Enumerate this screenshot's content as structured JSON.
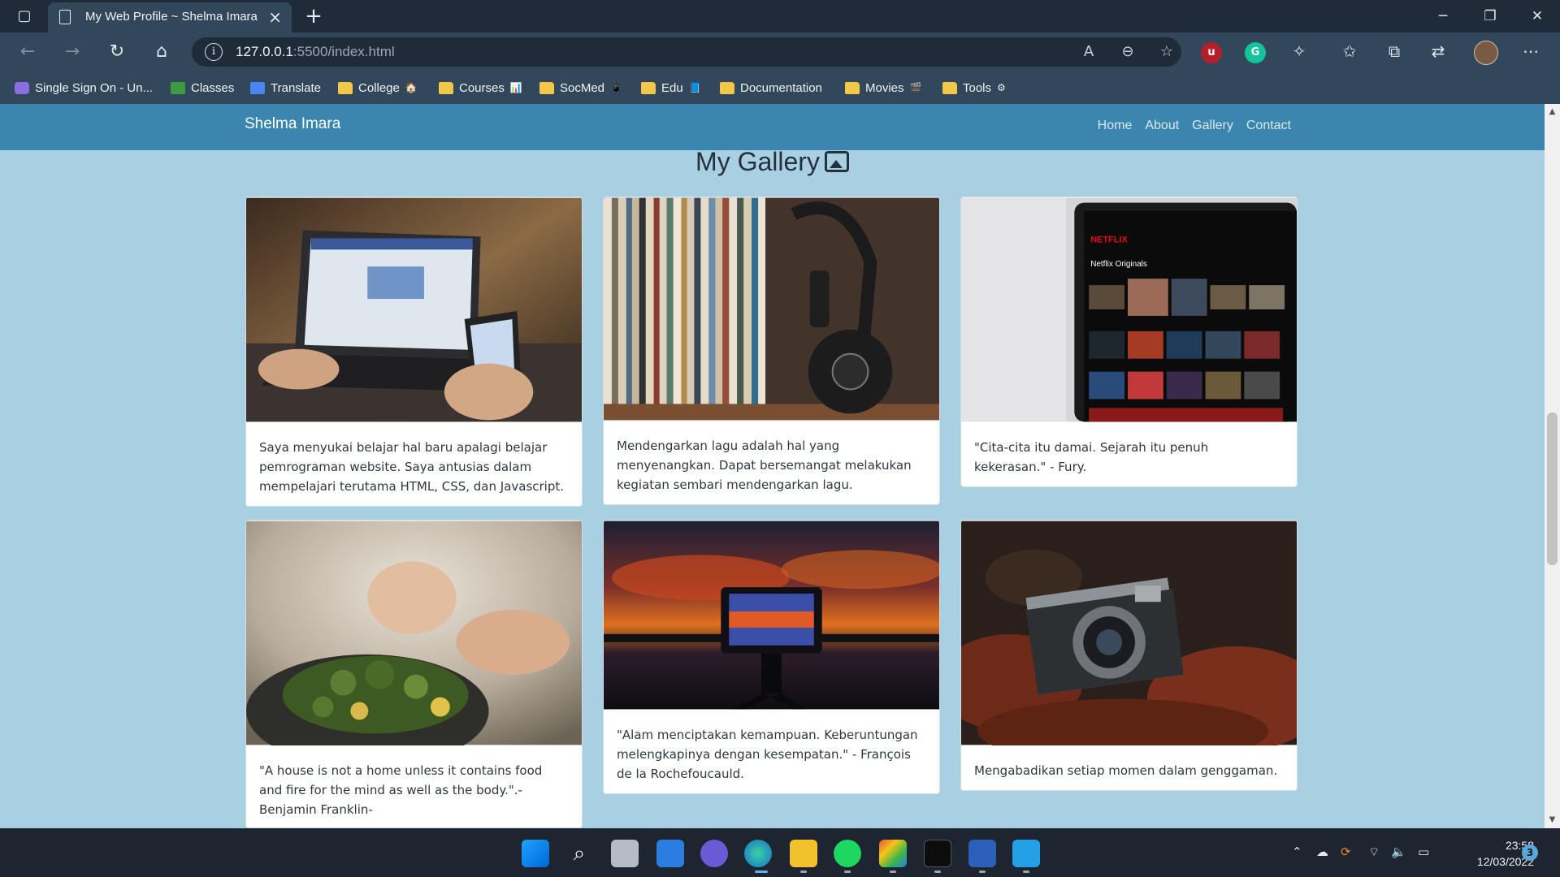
{
  "browser": {
    "tab_title": "My Web Profile ~ Shelma Imara",
    "url_host": "127.0.0.1",
    "url_rest": ":5500/index.html",
    "bookmarks": [
      {
        "label": "Single Sign On - Un...",
        "emoji": ""
      },
      {
        "label": "Classes",
        "emoji": ""
      },
      {
        "label": "Translate",
        "emoji": ""
      },
      {
        "label": "College",
        "emoji": "🏠"
      },
      {
        "label": "Courses",
        "emoji": "📊"
      },
      {
        "label": "SocMed",
        "emoji": "📱"
      },
      {
        "label": "Edu",
        "emoji": "📘"
      },
      {
        "label": "Documentation",
        "emoji": ""
      },
      {
        "label": "Movies",
        "emoji": "🎬"
      },
      {
        "label": "Tools",
        "emoji": "⚙"
      }
    ]
  },
  "site": {
    "brand": "Shelma Imara",
    "nav": [
      "Home",
      "About",
      "Gallery",
      "Contact"
    ],
    "gallery_title": "My Gallery",
    "cards": [
      {
        "image": "laptop-phone-photo",
        "text": "Saya menyukai belajar hal baru apalagi belajar pemrograman website. Saya antusias dalam mempelajari terutama HTML, CSS, dan Javascript."
      },
      {
        "image": "vinyl-headphones-photo",
        "text": "Mendengarkan lagu adalah hal yang menyenangkan. Dapat bersemangat melakukan kegiatan sembari mendengarkan lagu."
      },
      {
        "image": "netflix-tablet-photo",
        "text": "\"Cita-cita itu damai. Sejarah itu penuh kekerasan.\" - Fury."
      },
      {
        "image": "cooking-food-photo",
        "text": "\"A house is not a home unless it contains food and fire for the mind as well as the body.\".-Benjamin Franklin-"
      },
      {
        "image": "sunset-camera-photo",
        "text": "\"Alam menciptakan kemampuan. Keberuntungan melengkapinya dengan kesempatan.\" - François de la Rochefoucauld."
      },
      {
        "image": "vintage-camera-leaves-photo",
        "text": "Mengabadikan setiap momen dalam genggaman."
      }
    ],
    "thumbnail_labels": {
      "netflix_logo": "NETFLIX",
      "netflix_row": "Netflix Originals"
    }
  },
  "taskbar": {
    "time": "23:58",
    "date": "12/03/2022",
    "notifications": "3"
  },
  "colors": {
    "page_bg": "#a9cfe3",
    "nav_bg": "#3a86ae",
    "chrome_dark": "#1f2b38",
    "chrome": "#33475a"
  }
}
